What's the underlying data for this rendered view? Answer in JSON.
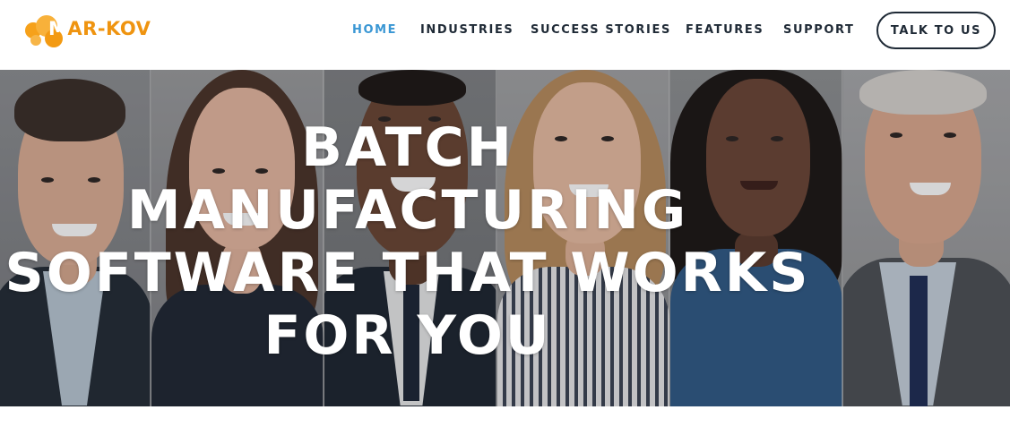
{
  "header": {
    "logo": {
      "first_letter": "M",
      "rest": "AR-KOV",
      "icon": "orange-bubbles-icon"
    },
    "nav": [
      {
        "label": "HOME",
        "active": true
      },
      {
        "label": "INDUSTRIES",
        "active": false
      },
      {
        "label": "SUCCESS STORIES",
        "active": false
      },
      {
        "label": "FEATURES",
        "active": false
      },
      {
        "label": "SUPPORT",
        "active": false
      }
    ],
    "cta_label": "TALK TO US"
  },
  "hero": {
    "title_lines": [
      "BATCH",
      "MANUFACTURING",
      "SOFTWARE THAT WORKS",
      "FOR YOU"
    ],
    "image_description_icons": [
      "person-photo-1",
      "person-photo-2",
      "person-photo-3",
      "person-photo-4",
      "person-photo-5",
      "person-photo-6"
    ]
  },
  "colors": {
    "brand_orange": "#f39a12",
    "nav_active": "#3a97d4",
    "nav_text": "#1f2a36",
    "hero_text": "#ffffff"
  }
}
